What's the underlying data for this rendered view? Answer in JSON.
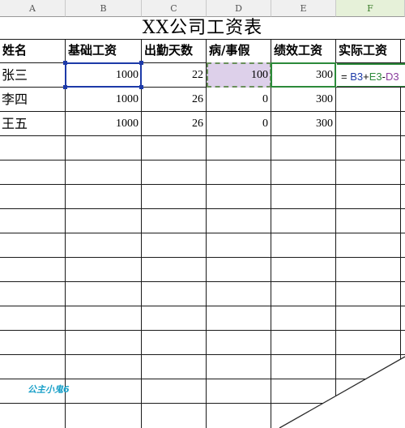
{
  "columns": [
    "A",
    "B",
    "C",
    "D",
    "E",
    "F"
  ],
  "active_column": "F",
  "title": "XX公司工资表",
  "headers": [
    "姓名",
    "基础工资",
    "出勤天数",
    "病/事假",
    "绩效工资",
    "实际工资"
  ],
  "rows": [
    {
      "name": "张三",
      "base": "1000",
      "days": "22",
      "leave": "100",
      "perf": "300"
    },
    {
      "name": "李四",
      "base": "1000",
      "days": "26",
      "leave": "0",
      "perf": "300"
    },
    {
      "name": "王五",
      "base": "1000",
      "days": "26",
      "leave": "0",
      "perf": "300"
    }
  ],
  "formula": {
    "prefix": "= ",
    "ref_b": "B3",
    "op1": "+",
    "ref_e": "E3",
    "op2": "-",
    "ref_d": "D3"
  },
  "watermark": "公主小鬼6",
  "colors": {
    "ref_b_border": "#1d3aa8",
    "ref_d_fill": "#ddd0ea",
    "ref_e_border": "#2c8a3a",
    "active_column_header": "#e6f1d9"
  }
}
